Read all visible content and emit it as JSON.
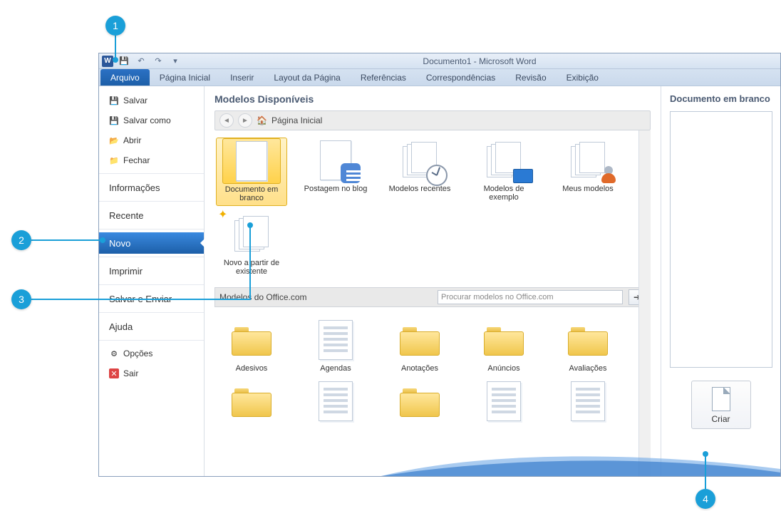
{
  "window": {
    "title": "Documento1  -  Microsoft Word"
  },
  "ribbon": {
    "file": "Arquivo",
    "tabs": [
      "Página Inicial",
      "Inserir",
      "Layout da Página",
      "Referências",
      "Correspondências",
      "Revisão",
      "Exibição"
    ]
  },
  "sidebar": {
    "save": "Salvar",
    "saveAs": "Salvar como",
    "open": "Abrir",
    "close": "Fechar",
    "info": "Informações",
    "recent": "Recente",
    "new": "Novo",
    "print": "Imprimir",
    "saveSend": "Salvar e Enviar",
    "help": "Ajuda",
    "options": "Opções",
    "exit": "Sair"
  },
  "templates": {
    "heading": "Modelos Disponíveis",
    "crumb": "Página Inicial",
    "items": [
      {
        "label": "Documento em branco",
        "kind": "blank",
        "selected": true
      },
      {
        "label": "Postagem no blog",
        "kind": "blog"
      },
      {
        "label": "Modelos recentes",
        "kind": "recent"
      },
      {
        "label": "Modelos de exemplo",
        "kind": "sample"
      },
      {
        "label": "Meus modelos",
        "kind": "my"
      },
      {
        "label": "Novo a partir de existente",
        "kind": "existing"
      }
    ],
    "officeHeading": "Modelos do Office.com",
    "searchPlaceholder": "Procurar modelos no Office.com",
    "categories": [
      "Adesivos",
      "Agendas",
      "Anotações",
      "Anúncios",
      "Avaliações"
    ]
  },
  "preview": {
    "title": "Documento em branco",
    "create": "Criar"
  },
  "callouts": {
    "c1": "1",
    "c2": "2",
    "c3": "3",
    "c4": "4"
  }
}
